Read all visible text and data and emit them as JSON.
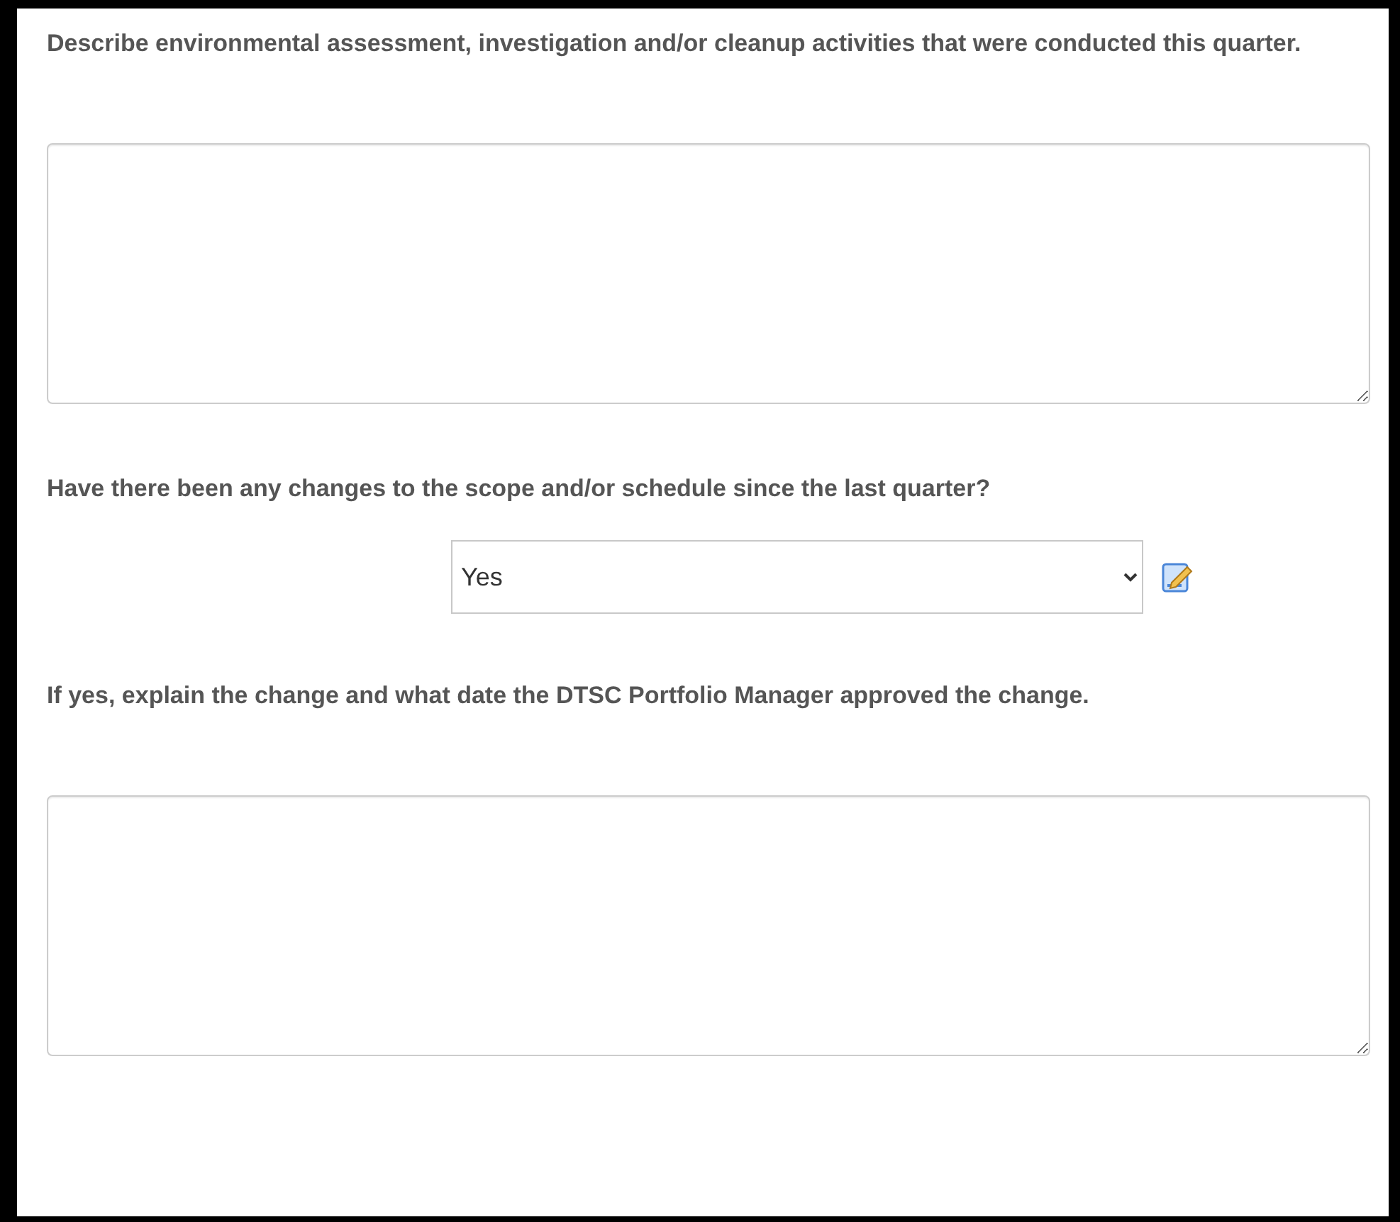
{
  "questions": [
    {
      "kind": "textarea",
      "label": "Describe environmental assessment, investigation and/or cleanup activities that were conducted this quarter."
    },
    {
      "kind": "select",
      "label": "Have there been any changes to the scope and/or schedule since the last quarter?",
      "value": "Yes"
    },
    {
      "kind": "textarea",
      "label": "If yes, explain the change and what date the DTSC Portfolio Manager approved the change."
    }
  ]
}
